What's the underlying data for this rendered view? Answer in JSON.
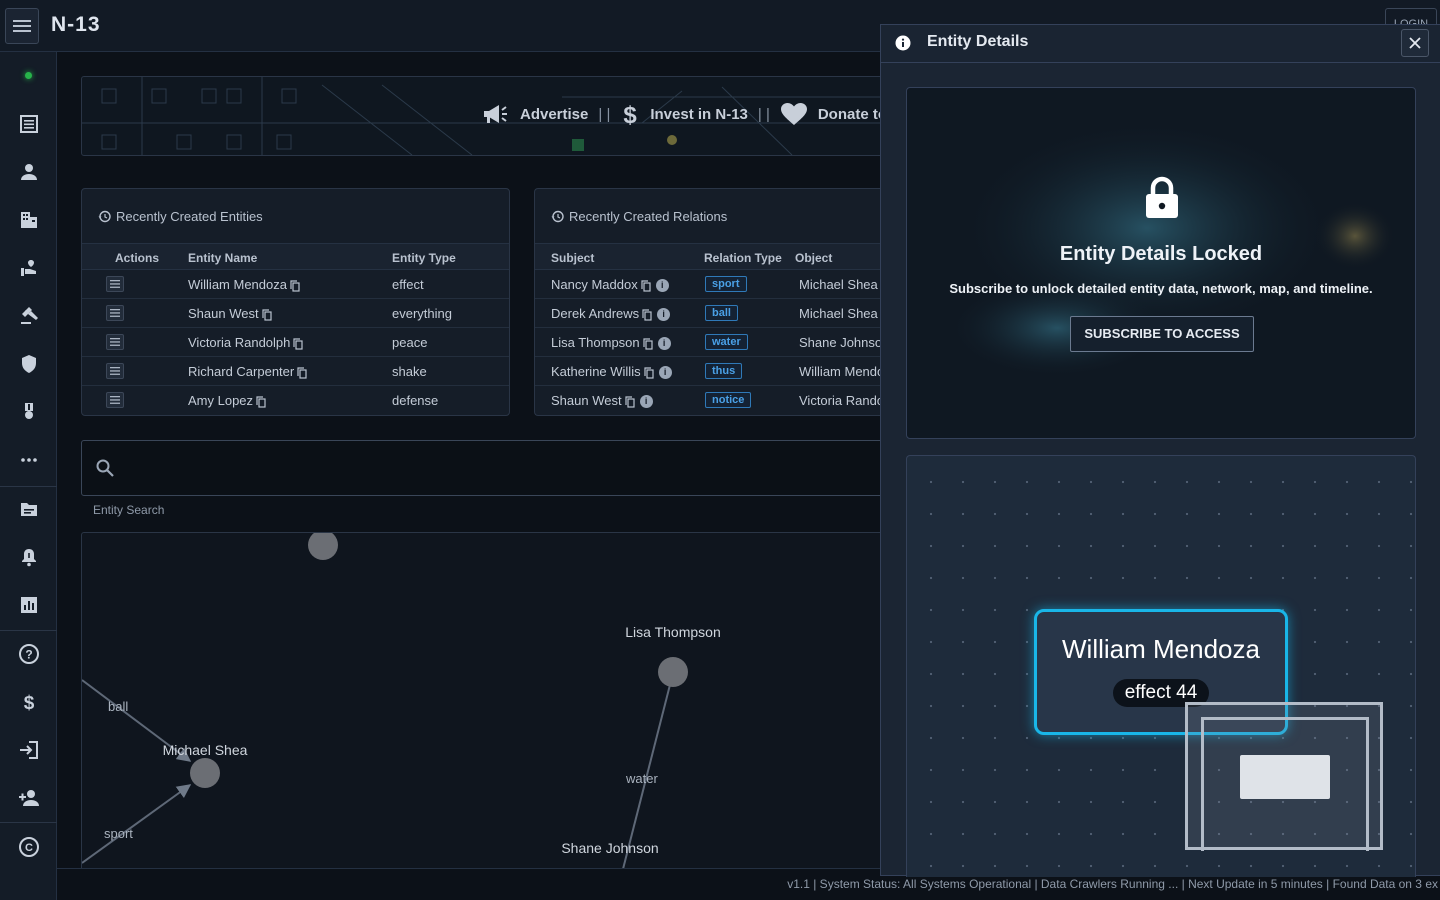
{
  "app": {
    "title": "N-13",
    "login_label": "LOGIN"
  },
  "banner": {
    "items": [
      {
        "icon": "megaphone-icon",
        "label": "Advertise"
      },
      {
        "icon": "dollar-icon",
        "label": "Invest in N-13"
      },
      {
        "icon": "heart-icon",
        "label": "Donate to"
      }
    ],
    "separator": "| |"
  },
  "entities_panel": {
    "title": "Recently Created Entities",
    "headers": {
      "actions": "Actions",
      "name": "Entity Name",
      "type": "Entity Type"
    },
    "rows": [
      {
        "name": "William Mendoza",
        "type": "effect"
      },
      {
        "name": "Shaun West",
        "type": "everything"
      },
      {
        "name": "Victoria Randolph",
        "type": "peace"
      },
      {
        "name": "Richard Carpenter",
        "type": "shake"
      },
      {
        "name": "Amy Lopez",
        "type": "defense"
      }
    ]
  },
  "relations_panel": {
    "title": "Recently Created Relations",
    "headers": {
      "subject": "Subject",
      "relation": "Relation Type",
      "object": "Object"
    },
    "rows": [
      {
        "subject": "Nancy Maddox",
        "relation": "sport",
        "object": "Michael Shea"
      },
      {
        "subject": "Derek Andrews",
        "relation": "ball",
        "object": "Michael Shea"
      },
      {
        "subject": "Lisa Thompson",
        "relation": "water",
        "object": "Shane Johnson"
      },
      {
        "subject": "Katherine Willis",
        "relation": "thus",
        "object": "William Mendoza"
      },
      {
        "subject": "Shaun West",
        "relation": "notice",
        "object": "Victoria Randolph"
      }
    ]
  },
  "search": {
    "label": "Entity Search",
    "value": "",
    "placeholder": ""
  },
  "graph": {
    "nodes": {
      "lisa": "Lisa Thompson",
      "michael": "Michael Shea",
      "shane": "Shane Johnson"
    },
    "edges": {
      "ball": "ball",
      "sport": "sport",
      "water": "water"
    }
  },
  "status_bar": "v1.1 | System Status: All Systems Operational | Data Crawlers Running ... | Next Update in 5 minutes | Found Data on 3 ex",
  "drawer": {
    "title": "Entity Details",
    "locked_title": "Entity Details Locked",
    "locked_message": "Subscribe to unlock detailed entity data, network, map, and timeline.",
    "subscribe_label": "SUBSCRIBE TO ACCESS",
    "entity_name": "William Mendoza",
    "entity_type": "effect 44"
  },
  "colors": {
    "accent": "#19b6e8",
    "tag": "#4aa0e6",
    "status_ok": "#27b34a"
  }
}
